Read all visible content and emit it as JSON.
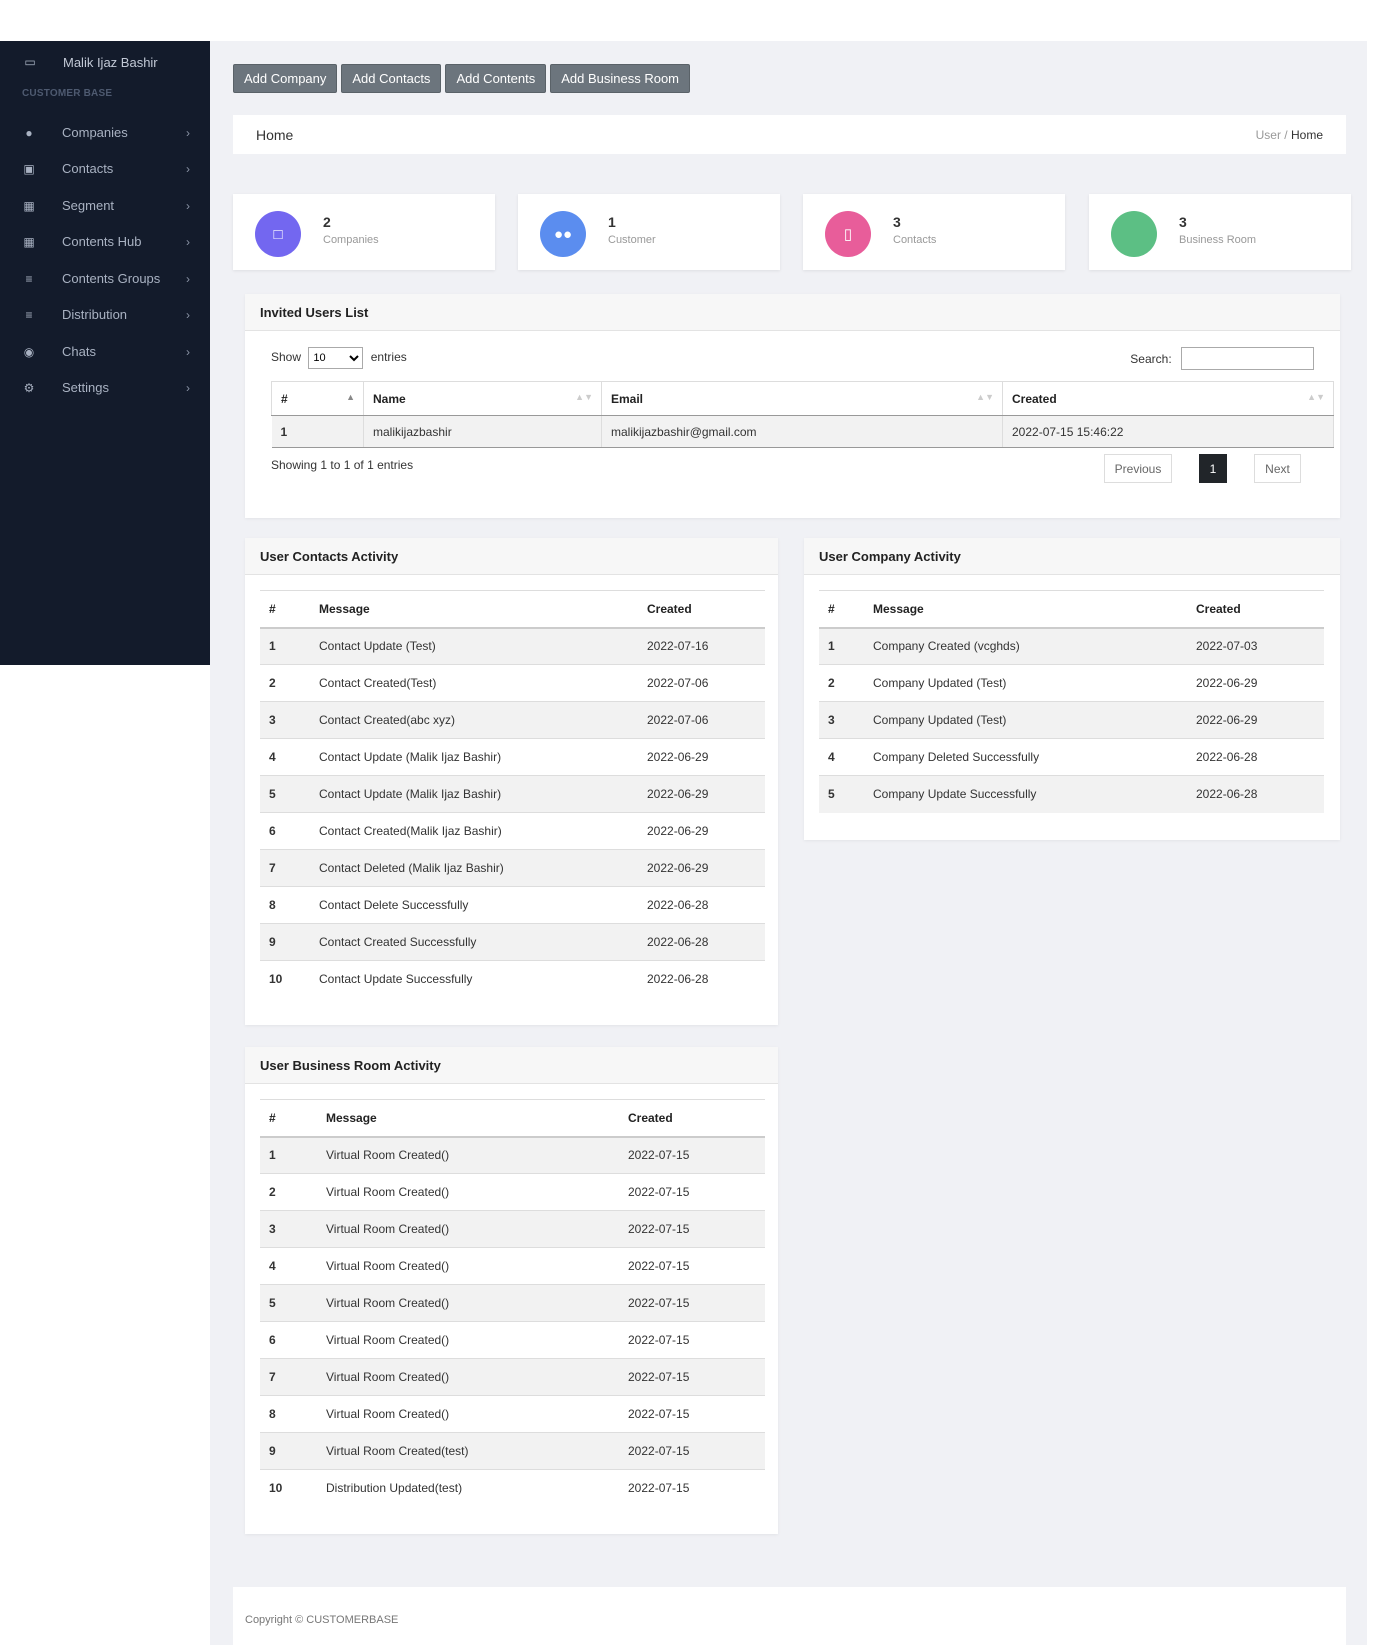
{
  "sidebar": {
    "user_name": "Malik Ijaz Bashir",
    "section_label": "CUSTOMER BASE",
    "items": [
      {
        "label": "Companies",
        "icon": "users-icon"
      },
      {
        "label": "Contacts",
        "icon": "contact-book-icon"
      },
      {
        "label": "Segment",
        "icon": "table-icon"
      },
      {
        "label": "Contents Hub",
        "icon": "table-icon"
      },
      {
        "label": "Contents Groups",
        "icon": "list-icon"
      },
      {
        "label": "Distribution",
        "icon": "list-icon"
      },
      {
        "label": "Chats",
        "icon": "chat-bubble-icon"
      },
      {
        "label": "Settings",
        "icon": "gears-icon"
      }
    ]
  },
  "toolbar": {
    "add_company": "Add Company",
    "add_contacts": "Add Contacts",
    "add_contents": "Add Contents",
    "add_business_room": "Add Business Room"
  },
  "breadcrumb": {
    "title": "Home",
    "parent": "User",
    "separator": "/",
    "current": "Home"
  },
  "stats": [
    {
      "value": "2",
      "label": "Companies",
      "color": "#7367f0",
      "icon": "square-icon"
    },
    {
      "value": "1",
      "label": "Customer",
      "color": "#5b8def",
      "icon": "users-outline-icon"
    },
    {
      "value": "3",
      "label": "Contacts",
      "color": "#e85d9a",
      "icon": "mobile-icon"
    },
    {
      "value": "3",
      "label": "Business Room",
      "color": "#5cbf84",
      "icon": ""
    }
  ],
  "invited": {
    "title": "Invited Users List",
    "show_label": "Show",
    "entries_value": "10",
    "entries_label": "entries",
    "search_label": "Search:",
    "columns": [
      "#",
      "Name",
      "Email",
      "Created"
    ],
    "rows": [
      {
        "idx": "1",
        "name": "malikijazbashir",
        "email": "malikijazbashir@gmail.com",
        "created": "2022-07-15 15:46:22"
      }
    ],
    "info": "Showing 1 to 1 of 1 entries",
    "prev": "Previous",
    "page": "1",
    "next": "Next"
  },
  "contacts_activity": {
    "title": "User Contacts Activity",
    "columns": [
      "#",
      "Message",
      "Created"
    ],
    "rows": [
      {
        "idx": "1",
        "message": "Contact Update (Test)",
        "created": "2022-07-16"
      },
      {
        "idx": "2",
        "message": "Contact Created(Test)",
        "created": "2022-07-06"
      },
      {
        "idx": "3",
        "message": "Contact Created(abc xyz)",
        "created": "2022-07-06"
      },
      {
        "idx": "4",
        "message": "Contact Update (Malik Ijaz Bashir)",
        "created": "2022-06-29"
      },
      {
        "idx": "5",
        "message": "Contact Update (Malik Ijaz Bashir)",
        "created": "2022-06-29"
      },
      {
        "idx": "6",
        "message": "Contact Created(Malik Ijaz Bashir)",
        "created": "2022-06-29"
      },
      {
        "idx": "7",
        "message": "Contact Deleted (Malik Ijaz Bashir)",
        "created": "2022-06-29"
      },
      {
        "idx": "8",
        "message": "Contact Delete Successfully",
        "created": "2022-06-28"
      },
      {
        "idx": "9",
        "message": "Contact Created Successfully",
        "created": "2022-06-28"
      },
      {
        "idx": "10",
        "message": "Contact Update Successfully",
        "created": "2022-06-28"
      }
    ]
  },
  "company_activity": {
    "title": "User Company Activity",
    "columns": [
      "#",
      "Message",
      "Created"
    ],
    "rows": [
      {
        "idx": "1",
        "message": "Company Created (vcghds)",
        "created": "2022-07-03"
      },
      {
        "idx": "2",
        "message": "Company Updated (Test)",
        "created": "2022-06-29"
      },
      {
        "idx": "3",
        "message": "Company Updated (Test)",
        "created": "2022-06-29"
      },
      {
        "idx": "4",
        "message": "Company Deleted Successfully",
        "created": "2022-06-28"
      },
      {
        "idx": "5",
        "message": "Company Update Successfully",
        "created": "2022-06-28"
      }
    ]
  },
  "room_activity": {
    "title": "User Business Room Activity",
    "columns": [
      "#",
      "Message",
      "Created"
    ],
    "rows": [
      {
        "idx": "1",
        "message": "Virtual Room Created()",
        "created": "2022-07-15"
      },
      {
        "idx": "2",
        "message": "Virtual Room Created()",
        "created": "2022-07-15"
      },
      {
        "idx": "3",
        "message": "Virtual Room Created()",
        "created": "2022-07-15"
      },
      {
        "idx": "4",
        "message": "Virtual Room Created()",
        "created": "2022-07-15"
      },
      {
        "idx": "5",
        "message": "Virtual Room Created()",
        "created": "2022-07-15"
      },
      {
        "idx": "6",
        "message": "Virtual Room Created()",
        "created": "2022-07-15"
      },
      {
        "idx": "7",
        "message": "Virtual Room Created()",
        "created": "2022-07-15"
      },
      {
        "idx": "8",
        "message": "Virtual Room Created()",
        "created": "2022-07-15"
      },
      {
        "idx": "9",
        "message": "Virtual Room Created(test)",
        "created": "2022-07-15"
      },
      {
        "idx": "10",
        "message": "Distribution Updated(test)",
        "created": "2022-07-15"
      }
    ]
  },
  "footer": {
    "copyright": "Copyright © CUSTOMERBASE"
  }
}
